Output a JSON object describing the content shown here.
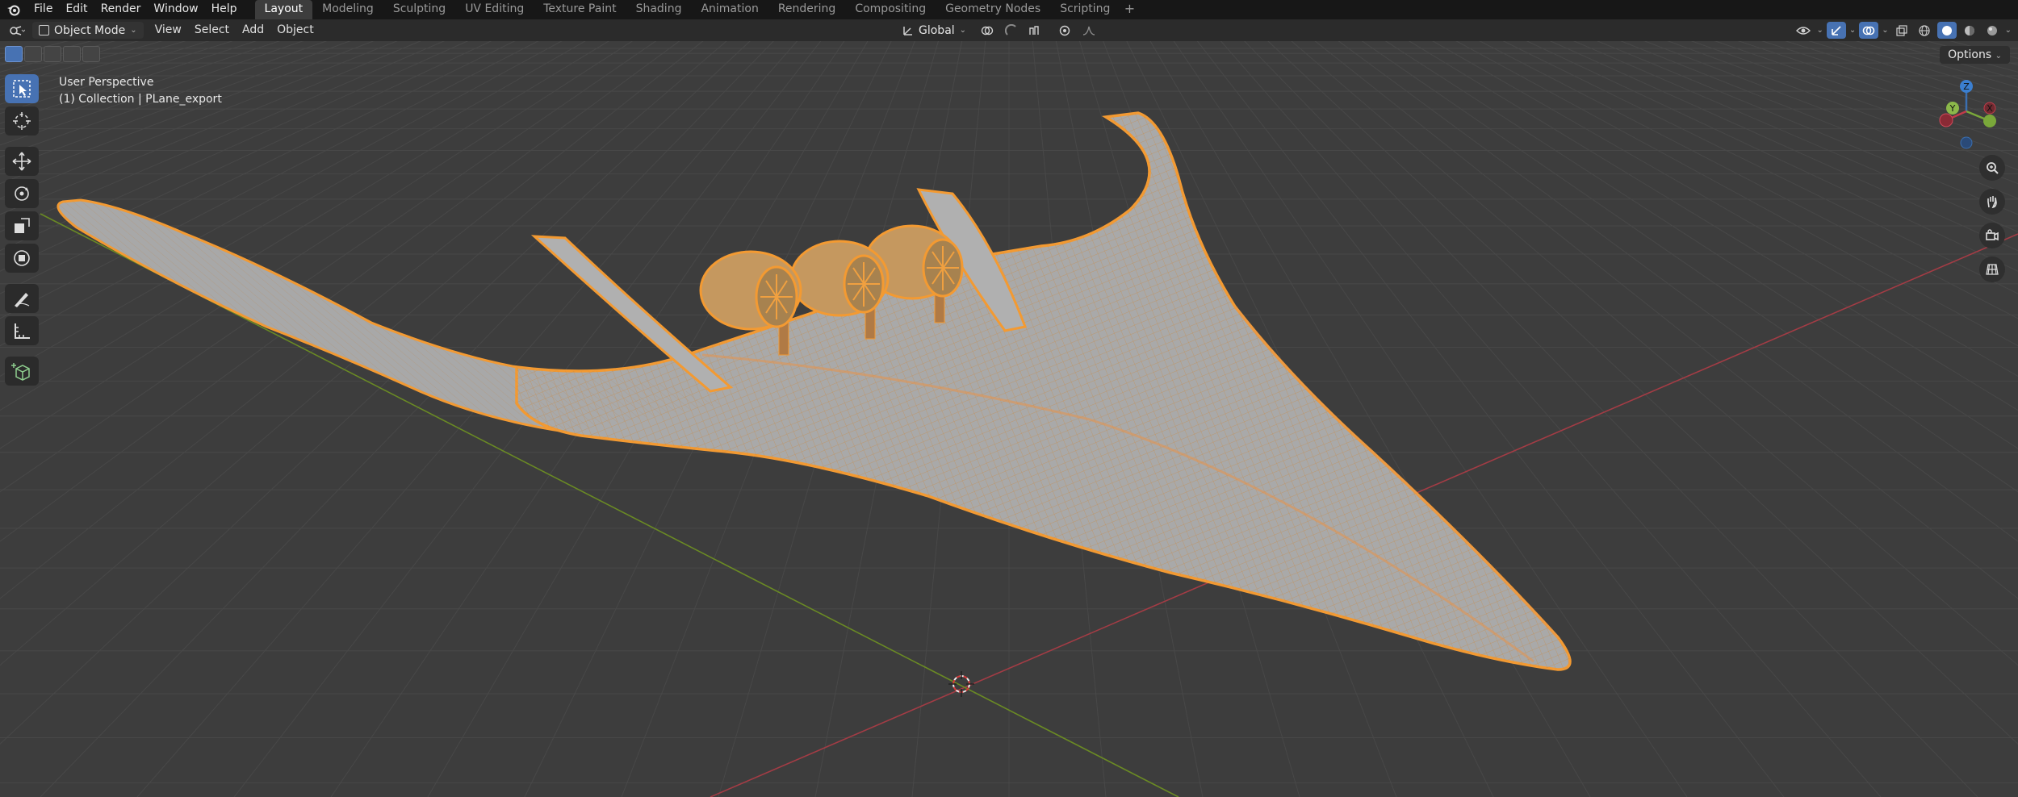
{
  "menu": [
    "File",
    "Edit",
    "Render",
    "Window",
    "Help"
  ],
  "workspaces": [
    {
      "label": "Layout",
      "active": true
    },
    {
      "label": "Modeling",
      "active": false
    },
    {
      "label": "Sculpting",
      "active": false
    },
    {
      "label": "UV Editing",
      "active": false
    },
    {
      "label": "Texture Paint",
      "active": false
    },
    {
      "label": "Shading",
      "active": false
    },
    {
      "label": "Animation",
      "active": false
    },
    {
      "label": "Rendering",
      "active": false
    },
    {
      "label": "Compositing",
      "active": false
    },
    {
      "label": "Geometry Nodes",
      "active": false
    },
    {
      "label": "Scripting",
      "active": false
    }
  ],
  "header": {
    "mode": "Object Mode",
    "view": "View",
    "select": "Select",
    "add": "Add",
    "object": "Object",
    "transform_orientation": "Global",
    "options": "Options"
  },
  "viewport": {
    "view_name": "User Perspective",
    "collection_info": "(1) Collection | PLane_export"
  },
  "gizmo": {
    "z": "Z",
    "y": "Y",
    "x": "X"
  },
  "colors": {
    "accent": "#4772b3",
    "selection": "#f0962e",
    "grid": "#474747",
    "x_axis": "#b5404a",
    "y_axis": "#7d9a2b"
  }
}
